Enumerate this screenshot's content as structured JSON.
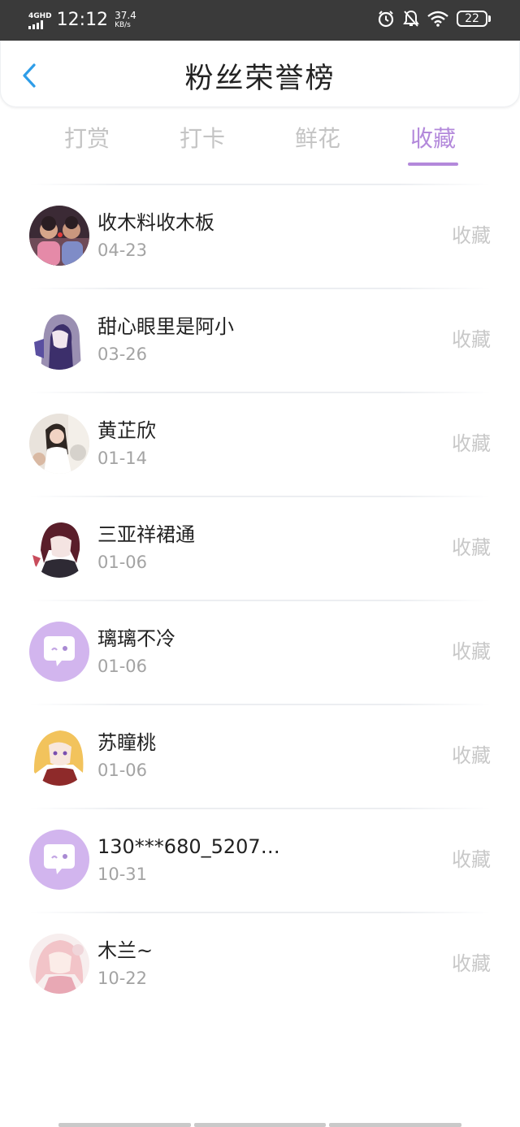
{
  "status_bar": {
    "network": "4GHD",
    "time": "12:12",
    "speed_value": "37.4",
    "speed_unit": "KB/s",
    "battery": "22",
    "icons": [
      "alarm-icon",
      "bell-muted-icon",
      "wifi-icon",
      "battery-icon"
    ]
  },
  "nav": {
    "back_icon": "chevron-left-icon",
    "title": "粉丝荣誉榜"
  },
  "tabs": [
    {
      "label": "打赏",
      "active": false
    },
    {
      "label": "打卡",
      "active": false
    },
    {
      "label": "鲜花",
      "active": false
    },
    {
      "label": "收藏",
      "active": true
    }
  ],
  "colors": {
    "accent": "#b389db",
    "status_bar": "#3a3a3a",
    "back_icon": "#2e9de8"
  },
  "fans": [
    {
      "name": "收木料收木板",
      "date": "04-23",
      "action": "收藏"
    },
    {
      "name": "甜心眼里是阿小",
      "date": "03-26",
      "action": "收藏"
    },
    {
      "name": "黄芷欣",
      "date": "01-14",
      "action": "收藏"
    },
    {
      "name": "三亚祥裙通",
      "date": "01-06",
      "action": "收藏"
    },
    {
      "name": "璃璃不冷",
      "date": "01-06",
      "action": "收藏"
    },
    {
      "name": "苏瞳桃",
      "date": "01-06",
      "action": "收藏"
    },
    {
      "name": "130***680_5207…",
      "date": "10-31",
      "action": "收藏"
    },
    {
      "name": "木兰~",
      "date": "10-22",
      "action": "收藏"
    }
  ]
}
